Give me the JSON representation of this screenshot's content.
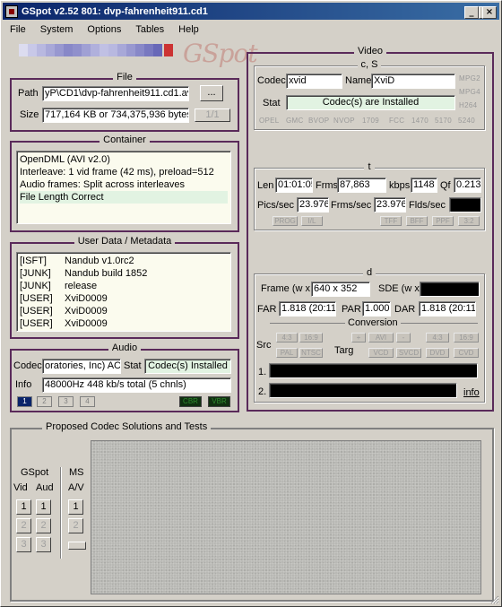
{
  "window": {
    "title": "GSpot v2.52 801: dvp-fahrenheit911.cd1",
    "min": "_",
    "max": "□",
    "close": "×"
  },
  "menu": [
    "File",
    "System",
    "Options",
    "Tables",
    "Help"
  ],
  "palette": [
    "#dcdcf0",
    "#c8c8e8",
    "#b8b8e0",
    "#a8a8d8",
    "#9898d0",
    "#8888c8",
    "#9090cc",
    "#a0a0d4",
    "#b0b0dc",
    "#c0c0e4",
    "#b8b8e0",
    "#a8a8d8",
    "#9898d0",
    "#8888c8",
    "#7878c0",
    "#6868b8",
    "#cc3333"
  ],
  "logo": "GSpot",
  "file": {
    "legend": "File",
    "path_label": "Path",
    "path_value": "yP\\CD1\\dvp-fahrenheit911.cd1.avi",
    "browse": "...",
    "size_label": "Size",
    "size_value": "717,164 KB or 734,375,936 bytes)",
    "part": "1/1"
  },
  "container": {
    "legend": "Container",
    "rows": [
      "OpenDML (AVI v2.0)",
      "Interleave: 1 vid frame (42 ms), preload=512",
      "Audio frames: Split across interleaves",
      "File Length Correct"
    ]
  },
  "userdata": {
    "legend": "User Data / Metadata",
    "rows": [
      [
        "[ISFT]",
        "Nandub v1.0rc2"
      ],
      [
        "[JUNK]",
        "Nandub build 1852"
      ],
      [
        "[JUNK]",
        "release"
      ],
      [
        "[USER]",
        "XviD0009"
      ],
      [
        "[USER]",
        "XviD0009"
      ],
      [
        "[USER]",
        "XviD0009"
      ]
    ]
  },
  "audio": {
    "legend": "Audio",
    "codec_label": "Codec",
    "codec_value": "oratories, Inc) AC3",
    "stat_label": "Stat",
    "stat_value": "Codec(s) Installed",
    "info_label": "Info",
    "info_value": "48000Hz  448 kb/s total (5 chnls)",
    "tabs": [
      "1",
      "2",
      "3",
      "4"
    ],
    "cbr": "CBR",
    "vbr": "VBR"
  },
  "video": {
    "legend": "Video",
    "cs_legend": "c, S",
    "codec_label": "Codec",
    "codec_value": "xvid",
    "name_label": "Name",
    "name_value": "XviD",
    "stat_label": "Stat",
    "stat_value": "Codec(s) are Installed",
    "side_tags": [
      "MPG2",
      "MPG4",
      "H264"
    ],
    "flags": [
      "OPEL",
      "GMC",
      "BVOP",
      "NVOP",
      "1709",
      "FCC",
      "1470",
      "5170",
      "5240"
    ],
    "t_legend": "t",
    "len_label": "Len",
    "len_value": "01:01:05",
    "frms_label": "Frms",
    "frms_value": "87,863",
    "kbps_label": "kbps",
    "kbps_value": "1148",
    "qf_label": "Qf",
    "qf_value": "0.213",
    "pics_label": "Pics/sec",
    "pics_value": "23.976",
    "frmssec_label": "Frms/sec",
    "frmssec_value": "23.976",
    "flds_label": "Flds/sec",
    "t_tags": [
      "PROG",
      "I/L",
      "TFF",
      "BFF",
      "PPF",
      "3:2"
    ],
    "d_legend": "d",
    "frame_label": "Frame (w x",
    "frame_value": "640 x 352",
    "sde_label": "SDE (w x",
    "far_label": "FAR",
    "far_value": "1.818 (20:11)",
    "par_label": "PAR",
    "par_value": "1.000",
    "dar_label": "DAR",
    "dar_value": "1.818 (20:11)",
    "conv_label": "Conversion",
    "src_label": "Src",
    "targ_label": "Targ",
    "src_tags": [
      "4:3",
      "16:9",
      "PAL",
      "NTSC"
    ],
    "targ_tags": [
      "+",
      "AVI",
      "-",
      "4:3",
      "16:9",
      "VCD",
      "SVCD",
      "DVD",
      "CVD"
    ],
    "line1": "1.",
    "line2": "2.",
    "info_link": "info"
  },
  "proposed": {
    "legend": "Proposed Codec Solutions and Tests",
    "gspot_label": "GSpot",
    "vid_label": "Vid",
    "aud_label": "Aud",
    "ms_label": "MS",
    "av_label": "A/V",
    "buttons": [
      "1",
      "2",
      "3"
    ]
  }
}
